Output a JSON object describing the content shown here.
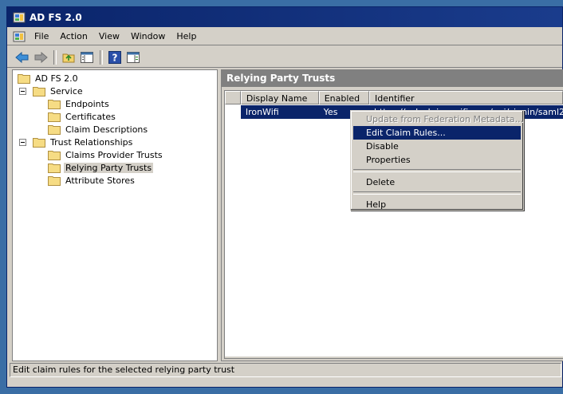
{
  "window": {
    "title": "AD FS 2.0"
  },
  "menubar": {
    "items": [
      "File",
      "Action",
      "View",
      "Window",
      "Help"
    ]
  },
  "toolbar": {
    "buttons": [
      "back-arrow-icon",
      "forward-arrow-icon",
      "up-folder-icon",
      "show-hide-tree-icon",
      "help-icon",
      "show-hide-action-pane-icon"
    ]
  },
  "tree": {
    "root": "AD FS 2.0",
    "service": "Service",
    "endpoints": "Endpoints",
    "certificates": "Certificates",
    "claim_descriptions": "Claim Descriptions",
    "trust_relationships": "Trust Relationships",
    "claims_provider_trusts": "Claims Provider Trusts",
    "relying_party_trusts": "Relying Party Trusts",
    "attribute_stores": "Attribute Stores"
  },
  "pane": {
    "title": "Relying Party Trusts",
    "columns": [
      "Display Name",
      "Enabled",
      "Identifier"
    ],
    "rows": [
      {
        "display_name": "IronWifi",
        "enabled": "Yes",
        "identifier": "https://splash.ironwifi.com/api/signin/saml2"
      }
    ]
  },
  "context_menu": {
    "items": [
      "Update from Federation Metadata...",
      "Edit Claim Rules...",
      "Disable",
      "Properties",
      "Delete",
      "Help"
    ]
  },
  "status": {
    "text": "Edit claim rules for the selected relying party trust"
  },
  "colors": {
    "desktop": "#3a6ea5",
    "title_bar": "#0a246a",
    "selection": "#0a246a",
    "chrome": "#d4d0c8"
  }
}
